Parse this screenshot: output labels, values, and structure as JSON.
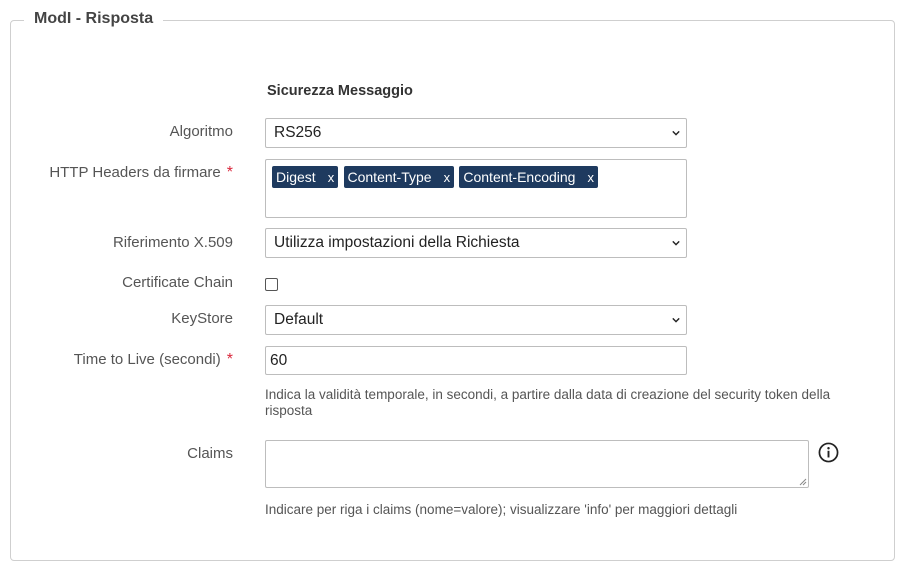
{
  "legend": "ModI - Risposta",
  "section_title": "Sicurezza Messaggio",
  "fields": {
    "algoritmo": {
      "label": "Algoritmo",
      "value": "RS256"
    },
    "http_headers": {
      "label": "HTTP Headers da firmare",
      "required_mark": "*",
      "tags": [
        "Digest",
        "Content-Type",
        "Content-Encoding"
      ],
      "remove_glyph": "x"
    },
    "riferimento": {
      "label": "Riferimento X.509",
      "value": "Utilizza impostazioni della Richiesta"
    },
    "certificate_chain": {
      "label": "Certificate Chain",
      "checked": false
    },
    "keystore": {
      "label": "KeyStore",
      "value": "Default"
    },
    "ttl": {
      "label": "Time to Live (secondi)",
      "required_mark": "*",
      "value": "60",
      "help": "Indica la validità temporale, in secondi, a partire dalla data di creazione del security token della risposta"
    },
    "claims": {
      "label": "Claims",
      "value": "",
      "help": "Indicare per riga i claims (nome=valore); visualizzare 'info' per maggiori dettagli",
      "info_icon": "info-circle-icon"
    }
  },
  "colors": {
    "tag_bg": "#1e3a5f",
    "required": "#d9263b",
    "border": "#cfcfcf"
  }
}
